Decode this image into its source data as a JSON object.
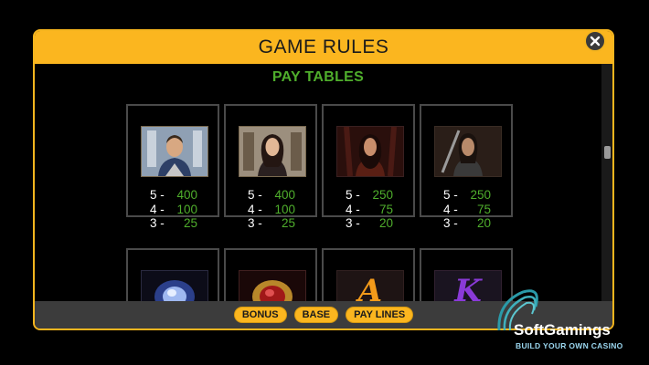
{
  "modal": {
    "title": "GAME RULES"
  },
  "section_title": "PAY TABLES",
  "symbols": [
    {
      "name": "knight",
      "payouts": [
        {
          "key": "5 -",
          "val": "400"
        },
        {
          "key": "4 -",
          "val": "100"
        },
        {
          "key": "3 -",
          "val": "25"
        }
      ]
    },
    {
      "name": "lady",
      "payouts": [
        {
          "key": "5 -",
          "val": "400"
        },
        {
          "key": "4 -",
          "val": "100"
        },
        {
          "key": "3 -",
          "val": "25"
        }
      ]
    },
    {
      "name": "warrior-woman",
      "payouts": [
        {
          "key": "5 -",
          "val": "250"
        },
        {
          "key": "4 -",
          "val": "75"
        },
        {
          "key": "3 -",
          "val": "20"
        }
      ]
    },
    {
      "name": "warrior-man",
      "payouts": [
        {
          "key": "5 -",
          "val": "250"
        },
        {
          "key": "4 -",
          "val": "75"
        },
        {
          "key": "3 -",
          "val": "20"
        }
      ]
    },
    {
      "name": "blue-gem",
      "payouts": []
    },
    {
      "name": "red-gem",
      "payouts": []
    },
    {
      "name": "letter-a",
      "glyph": "A",
      "payouts": []
    },
    {
      "name": "letter-k",
      "glyph": "K",
      "payouts": []
    }
  ],
  "footer": {
    "buttons": [
      "BONUS",
      "BASE",
      "PAY LINES"
    ]
  },
  "logo": {
    "name": "SoftGamings",
    "tagline": "BUILD YOUR OWN CASINO"
  },
  "colors": {
    "accent": "#fbb61f",
    "pay_green": "#4fae2c",
    "footer_bg": "#3c3c3c"
  }
}
